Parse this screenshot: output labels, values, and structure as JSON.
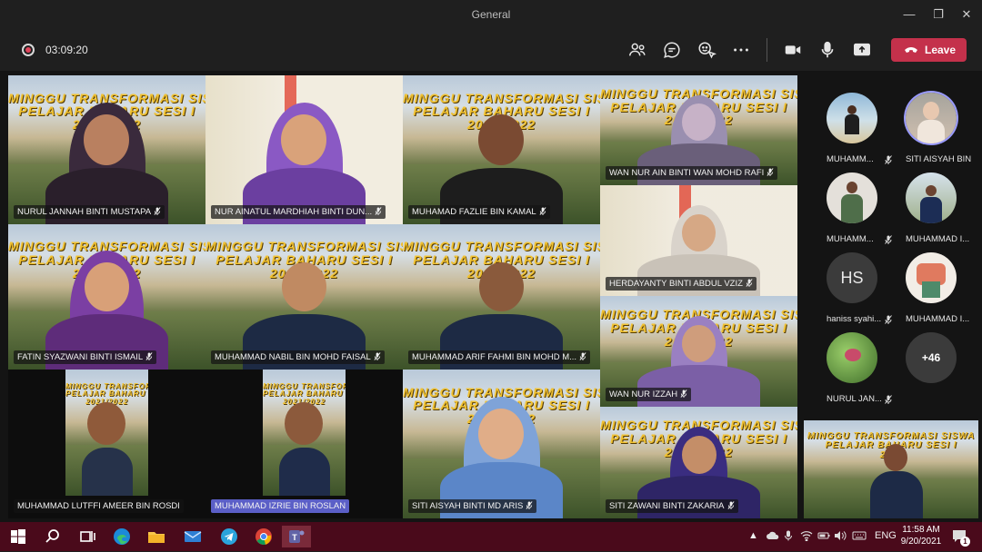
{
  "window": {
    "title": "General",
    "minimize": "—",
    "restore": "❐",
    "close": "✕"
  },
  "toolbar": {
    "timer": "03:09:20",
    "leave_label": "Leave"
  },
  "banner": {
    "line1": "MINGGU TRANSFORMASI SISWA",
    "line2": "PELAJAR BAHARU SESI I",
    "line3": "2021/2022"
  },
  "tiles": [
    {
      "name": "NURUL JANNAH BINTI MUSTAPA",
      "skin": "#b98060",
      "cloth": "#2a1f2b",
      "hijab": "#3a2a3c"
    },
    {
      "name": "NUR AINATUL MARDHIAH BINTI DUN...",
      "skin": "#d9a27a",
      "cloth": "#6b3fa0",
      "hijab": "#8a59c4"
    },
    {
      "name": "MUHAMAD FAZLIE BIN KAMAL",
      "skin": "#7a4a32",
      "cloth": "#1d1d1d",
      "hijab": ""
    },
    {
      "name": "WAN NUR AIN BINTI WAN MOHD RAFI",
      "skin": "#c7b2c7",
      "cloth": "#6a5f7a",
      "hijab": "#9a8fb0"
    },
    {
      "name": "FATIN SYAZWANI BINTI ISMAIL",
      "skin": "#d8a078",
      "cloth": "#5e2c7a",
      "hijab": "#7b3fa3"
    },
    {
      "name": "MUHAMMAD NABIL BIN MOHD FAISAL",
      "skin": "#c08a62",
      "cloth": "#1d2a44",
      "hijab": ""
    },
    {
      "name": "MUHAMMAD ARIF FAHMI BIN MOHD M...",
      "skin": "#8a5a3c",
      "cloth": "#1d2a44",
      "hijab": ""
    },
    {
      "name": "HERDAYANTY BINTI ABDUL VZIZ",
      "skin": "#d6a885",
      "cloth": "#c9c2b8",
      "hijab": "#d9d3cb"
    },
    {
      "name": "WAN NUR IZZAH",
      "skin": "#cf9d7c",
      "cloth": "#7b5fa6",
      "hijab": "#9a80c2"
    },
    {
      "name": "MUHAMMAD LUTFFI AMEER BIN ROSDI",
      "skin": "#8f5a3a",
      "cloth": "#26324a",
      "hijab": ""
    },
    {
      "name": "MUHAMMAD IZRIE BIN ROSLAN",
      "skin": "#8c5a3c",
      "cloth": "#1f2c4a",
      "hijab": ""
    },
    {
      "name": "SITI AISYAH BINTI MD ARIS",
      "skin": "#e0ad88",
      "cloth": "#5b86c8",
      "hijab": "#7fa3d8"
    },
    {
      "name": "SITI ZAWANI BINTI ZAKARIA",
      "skin": "#c48e68",
      "cloth": "#2e2566",
      "hijab": "#3a2d80"
    }
  ],
  "side": {
    "participants": [
      {
        "label": "MUHAMM...",
        "initials": ""
      },
      {
        "label": "SITI AISYAH BIN...",
        "initials": ""
      },
      {
        "label": "MUHAMM...",
        "initials": ""
      },
      {
        "label": "MUHAMMAD I...",
        "initials": ""
      },
      {
        "label": "haniss syahi...",
        "initials": "HS"
      },
      {
        "label": "MUHAMMAD I...",
        "initials": ""
      },
      {
        "label": "NURUL JAN...",
        "initials": ""
      }
    ],
    "more_count": "+46"
  },
  "selfview": {
    "line1": "MINGGU TRANSFORMASI SISWA",
    "line2": "PELAJAR BAHARU SESI I",
    "line3": "20..."
  },
  "taskbar": {
    "time": "11:58 AM",
    "date": "9/20/2021",
    "lang": "ENG",
    "notif_count": "1"
  },
  "colors": {
    "accent": "#5b5fc7",
    "leave": "#c4314b",
    "taskbar": "#4a0a1b",
    "title_gold": "#f1c232"
  }
}
